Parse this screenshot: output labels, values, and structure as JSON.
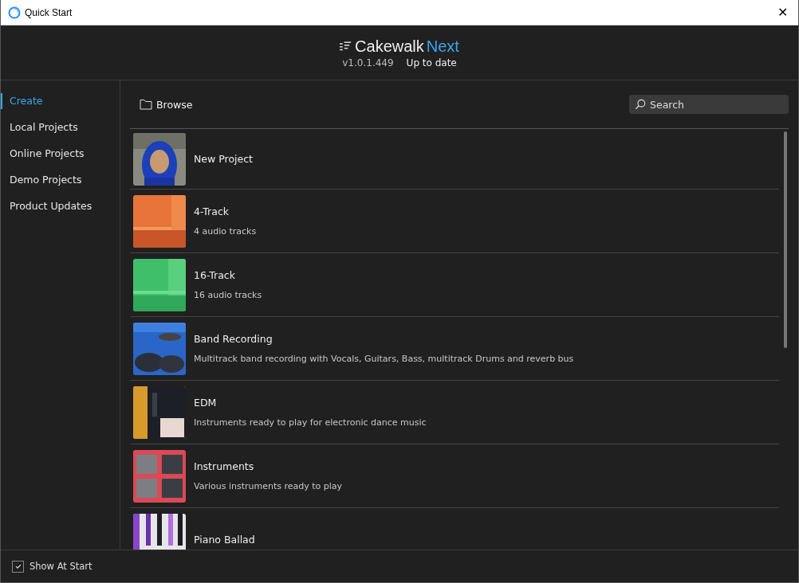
{
  "window": {
    "title": "Quick Start",
    "close": "✕"
  },
  "header": {
    "brand": "Cakewalk",
    "brand_accent": "Next",
    "version": "v1.0.1.449",
    "update_status": "Up to date"
  },
  "sidebar": {
    "items": [
      {
        "label": "Create",
        "selected": true
      },
      {
        "label": "Local Projects",
        "selected": false
      },
      {
        "label": "Online Projects",
        "selected": false
      },
      {
        "label": "Demo Projects",
        "selected": false
      },
      {
        "label": "Product Updates",
        "selected": false
      }
    ]
  },
  "toolbar": {
    "browse": "Browse",
    "search": {
      "placeholder": "Search"
    }
  },
  "templates": [
    {
      "title": "New Project"
    },
    {
      "title": "4-Track",
      "description": "4 audio tracks"
    },
    {
      "title": "16-Track",
      "description": "16 audio tracks"
    },
    {
      "title": "Band Recording",
      "description": "Multitrack band recording with Vocals, Guitars, Bass, multitrack Drums and reverb bus"
    },
    {
      "title": "EDM",
      "description": "Instruments ready to play for electronic dance music"
    },
    {
      "title": "Instruments",
      "description": "Various instruments ready to play"
    },
    {
      "title": "Piano Ballad"
    }
  ],
  "footer": {
    "show_at_start": {
      "label": "Show At Start",
      "checked": true
    }
  }
}
